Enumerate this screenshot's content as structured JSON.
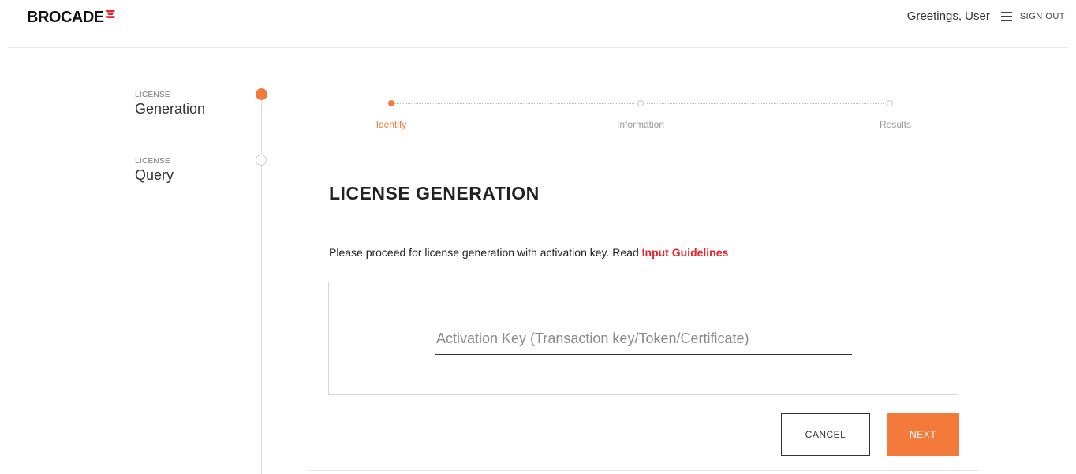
{
  "header": {
    "brand": "BROCADE",
    "greeting": "Greetings, User",
    "menu_icon": "hamburger-menu-icon",
    "signout_label": "SIGN OUT"
  },
  "sidebar": {
    "items": [
      {
        "caption": "LICENSE",
        "label": "Generation",
        "active": true
      },
      {
        "caption": "LICENSE",
        "label": "Query",
        "active": false
      }
    ]
  },
  "stepper": {
    "steps": [
      {
        "label": "Identify",
        "active": true
      },
      {
        "label": "Information",
        "active": false
      },
      {
        "label": "Results",
        "active": false
      }
    ]
  },
  "main": {
    "title": "LICENSE GENERATION",
    "intro_text": "Please proceed for license generation with activation key. Read ",
    "intro_link": "Input Guidelines",
    "activation_key": {
      "placeholder": "Activation Key (Transaction key/Token/Certificate)",
      "value": ""
    },
    "cancel_label": "CANCEL",
    "next_label": "NEXT"
  },
  "colors": {
    "accent": "#f37a3a",
    "link": "#e8242b",
    "text": "#222222",
    "muted": "#999999"
  }
}
